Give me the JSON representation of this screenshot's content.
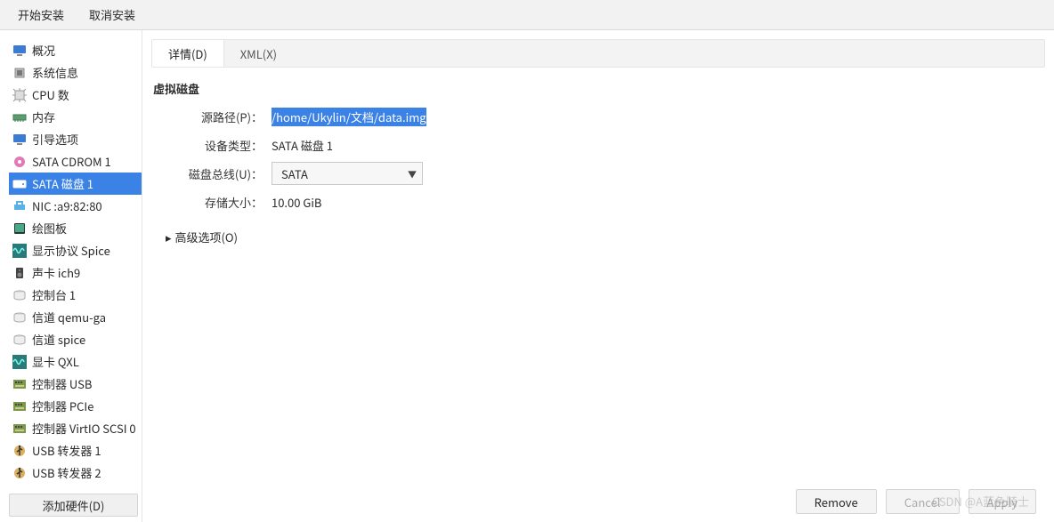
{
  "toolbar": {
    "begin_install": "开始安装",
    "cancel_install": "取消安装"
  },
  "sidebar": {
    "items": [
      {
        "icon": "monitor",
        "label": "概况"
      },
      {
        "icon": "chip",
        "label": "系统信息"
      },
      {
        "icon": "cpu",
        "label": "CPU 数"
      },
      {
        "icon": "ram",
        "label": "内存"
      },
      {
        "icon": "monitor",
        "label": "引导选项"
      },
      {
        "icon": "disc",
        "label": "SATA CDROM 1"
      },
      {
        "icon": "hdd",
        "label": "SATA 磁盘 1"
      },
      {
        "icon": "nic",
        "label": "NIC :a9:82:80"
      },
      {
        "icon": "tablet",
        "label": "绘图板"
      },
      {
        "icon": "wave",
        "label": "显示协议 Spice"
      },
      {
        "icon": "speaker",
        "label": "声卡 ich9"
      },
      {
        "icon": "console",
        "label": "控制台 1"
      },
      {
        "icon": "channel",
        "label": "信道 qemu-ga"
      },
      {
        "icon": "channel",
        "label": "信道 spice"
      },
      {
        "icon": "wave",
        "label": "显卡 QXL"
      },
      {
        "icon": "ctrl",
        "label": "控制器 USB"
      },
      {
        "icon": "ctrl",
        "label": "控制器 PCIe"
      },
      {
        "icon": "ctrl",
        "label": "控制器 VirtIO SCSI 0"
      },
      {
        "icon": "usb",
        "label": "USB 转发器 1"
      },
      {
        "icon": "usb",
        "label": "USB 转发器 2"
      }
    ],
    "selected_index": 6,
    "add_hw": "添加硬件(D)"
  },
  "tabs": {
    "details": "详情(D)",
    "xml": "XML(X)",
    "active": 0
  },
  "disk": {
    "section_title": "虚拟磁盘",
    "source_path_label": "源路径(P)：",
    "source_path": "/home/Ukylin/文档/data.img",
    "device_type_label": "设备类型：",
    "device_type": "SATA 磁盘 1",
    "bus_label": "磁盘总线(U)：",
    "bus": "SATA",
    "size_label": "存储大小：",
    "size": "10.00 GiB",
    "advanced": "高级选项(O)"
  },
  "footer": {
    "remove": "Remove",
    "cancel": "Cancel",
    "apply": "Apply"
  },
  "watermark": "CSDN @A蓝色骑士"
}
